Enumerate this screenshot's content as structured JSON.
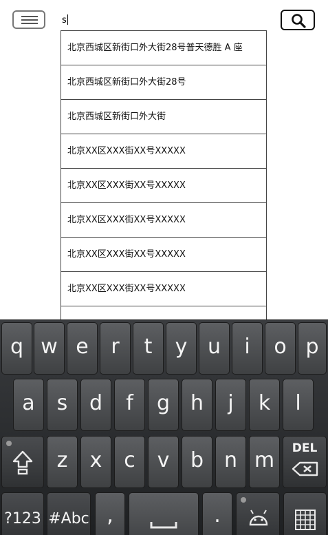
{
  "search": {
    "query": "s"
  },
  "suggestions": [
    "北京西城区新街口外大街28号普天德胜 A 座",
    "北京西城区新街口外大街28号",
    "北京西城区新街口外大街",
    "北京XX区XXX街XX号XXXXX",
    "北京XX区XXX街XX号XXXXX",
    "北京XX区XXX街XX号XXXXX",
    "北京XX区XXX街XX号XXXXX",
    "北京XX区XXX街XX号XXXXX",
    ""
  ],
  "keyboard": {
    "row1": [
      "q",
      "w",
      "e",
      "r",
      "t",
      "y",
      "u",
      "i",
      "o",
      "p"
    ],
    "row2": [
      "a",
      "s",
      "d",
      "f",
      "g",
      "h",
      "j",
      "k",
      "l"
    ],
    "row3": [
      "z",
      "x",
      "c",
      "v",
      "b",
      "n",
      "m"
    ],
    "del_label": "DEL",
    "symbols_label": "?123",
    "mode_label": "#Abc",
    "comma_label": ",",
    "period_label": ".",
    "mode_indicator_color": "#b9e34a",
    "icons": [
      "menu-icon",
      "search-icon",
      "shift-icon",
      "backspace-icon",
      "space-icon",
      "android-icon",
      "keypad-icon"
    ]
  }
}
